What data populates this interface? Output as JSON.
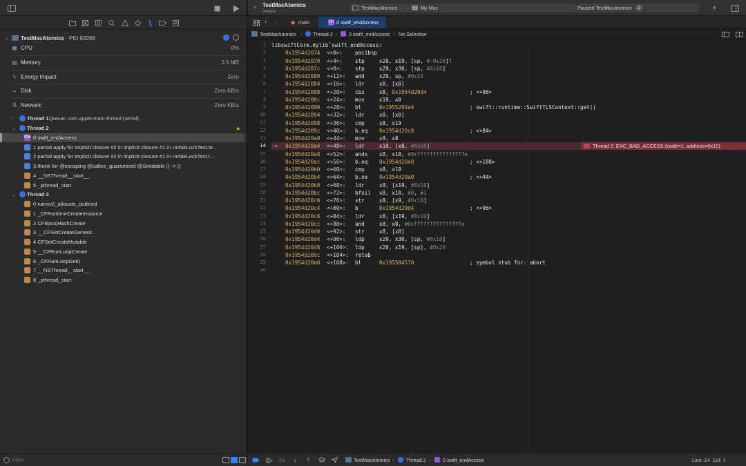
{
  "window": {
    "project_name": "TestMacAtomics",
    "branch": "master",
    "status": "Paused TestMacAtomics",
    "status_count": "2"
  },
  "scheme": {
    "scheme_name": "TestMacAtomics",
    "destination": "My Mac"
  },
  "tabs": [
    {
      "label": "main"
    },
    {
      "label": "0 swift_endAccess"
    }
  ],
  "jumpbar": {
    "crumbs": [
      "TestMacAtomics",
      "Thread 2",
      "0 swift_endAccess",
      "No Selection"
    ]
  },
  "process": {
    "name": "TestMacAtomics",
    "pid": "PID 83298"
  },
  "gauges": [
    {
      "label": "CPU",
      "value": "0%",
      "icon": "cpu-icon"
    },
    {
      "label": "Memory",
      "value": "3.5 MB",
      "icon": "memory-icon"
    },
    {
      "label": "Energy Impact",
      "value": "Zero",
      "icon": "energy-icon"
    },
    {
      "label": "Disk",
      "value": "Zero KB/s",
      "icon": "disk-icon"
    },
    {
      "label": "Network",
      "value": "Zero KB/s",
      "icon": "network-icon"
    }
  ],
  "threads": [
    {
      "label": "Thread 1",
      "queue": "Queue: com.apple.main-thread (serial)",
      "expanded": false,
      "frames": []
    },
    {
      "label": "Thread 2",
      "queue": "",
      "expanded": true,
      "warning": true,
      "frames": [
        {
          "label": "0 swift_endAccess",
          "icon": "purple",
          "selected": true
        },
        {
          "label": "1 partial apply for implicit closure #2 in implicit closure #1 in UnfairLockTest.te...",
          "icon": "blue"
        },
        {
          "label": "2 partial apply for implicit closure #2 in implicit closure #1 in UnfairLockTest.t...",
          "icon": "blue"
        },
        {
          "label": "3 thunk for @escaping @callee_guaranteed @Sendable () -> ()",
          "icon": "blue"
        },
        {
          "label": "4 __NSThread__start__",
          "icon": "tan"
        },
        {
          "label": "5 _pthread_start",
          "icon": "tan"
        }
      ]
    },
    {
      "label": "Thread 3",
      "queue": "",
      "expanded": true,
      "frames": [
        {
          "label": "0 nanov2_allocate_outlined",
          "icon": "tan"
        },
        {
          "label": "1 _CFRuntimeCreateInstance",
          "icon": "tan"
        },
        {
          "label": "2 CFBasicHashCreate",
          "icon": "tan"
        },
        {
          "label": "3 __CFSetCreateGeneric",
          "icon": "tan"
        },
        {
          "label": "4 CFSetCreateMutable",
          "icon": "tan"
        },
        {
          "label": "5 __CFRunLoopCreate",
          "icon": "tan"
        },
        {
          "label": "6 _CFRunLoopGet0",
          "icon": "tan"
        },
        {
          "label": "7 __NSThread__start__",
          "icon": "tan"
        },
        {
          "label": "8 _pthread_start",
          "icon": "tan"
        }
      ]
    }
  ],
  "filter_placeholder": "Filter",
  "code": {
    "header": "libswiftCore.dylib`swift_endAccess:",
    "lines": [
      {
        "addr": "0x1954d2074",
        "off": "<+0>:",
        "op": "pacibsp",
        "args": "",
        "comment": ""
      },
      {
        "addr": "0x1954d2078",
        "off": "<+4>:",
        "op": "stp",
        "args": "x20, x19, [sp, #-0x20]!",
        "comment": ""
      },
      {
        "addr": "0x1954d207c",
        "off": "<+8>:",
        "op": "stp",
        "args": "x29, x30, [sp, #0x10]",
        "comment": ""
      },
      {
        "addr": "0x1954d2080",
        "off": "<+12>:",
        "op": "add",
        "args": "x29, sp, #0x10",
        "comment": ""
      },
      {
        "addr": "0x1954d2084",
        "off": "<+16>:",
        "op": "ldr",
        "args": "x8, [x0]",
        "comment": ""
      },
      {
        "addr": "0x1954d2088",
        "off": "<+20>:",
        "op": "cbz",
        "args": "x8, 0x1954d20d4",
        "comment": "; <+96>"
      },
      {
        "addr": "0x1954d208c",
        "off": "<+24>:",
        "op": "mov",
        "args": "x19, x0",
        "comment": ""
      },
      {
        "addr": "0x1954d2090",
        "off": "<+28>:",
        "op": "bl",
        "args": "0x1955296a4",
        "comment": "; swift::runtime::SwiftTLSContext::get()"
      },
      {
        "addr": "0x1954d2094",
        "off": "<+32>:",
        "op": "ldr",
        "args": "x8, [x0]",
        "comment": ""
      },
      {
        "addr": "0x1954d2098",
        "off": "<+36>:",
        "op": "cmp",
        "args": "x8, x19",
        "comment": ""
      },
      {
        "addr": "0x1954d209c",
        "off": "<+40>:",
        "op": "b.eq",
        "args": "0x1954d20c8",
        "comment": "; <+84>"
      },
      {
        "addr": "0x1954d20a0",
        "off": "<+44>:",
        "op": "mov",
        "args": "x9, x8",
        "comment": ""
      },
      {
        "addr": "0x1954d20a4",
        "off": "<+48>:",
        "op": "ldr",
        "args": "x10, [x8, #0x10]",
        "comment": ""
      },
      {
        "addr": "0x1954d20a8",
        "off": "<+52>:",
        "op": "ands",
        "args": "x8, x10, #0xfffffffffffffffe",
        "comment": ""
      },
      {
        "addr": "0x1954d20ac",
        "off": "<+56>:",
        "op": "b.eq",
        "args": "0x1954d20e0",
        "comment": "; <+108>"
      },
      {
        "addr": "0x1954d20b0",
        "off": "<+60>:",
        "op": "cmp",
        "args": "x8, x19",
        "comment": ""
      },
      {
        "addr": "0x1954d20b4",
        "off": "<+64>:",
        "op": "b.ne",
        "args": "0x1954d20a0",
        "comment": "; <+44>"
      },
      {
        "addr": "0x1954d20b8",
        "off": "<+68>:",
        "op": "ldr",
        "args": "x8, [x19, #0x10]",
        "comment": ""
      },
      {
        "addr": "0x1954d20bc",
        "off": "<+72>:",
        "op": "bfxil",
        "args": "x8, x10, #0, #1",
        "comment": ""
      },
      {
        "addr": "0x1954d20c0",
        "off": "<+76>:",
        "op": "str",
        "args": "x8, [x9, #0x10]",
        "comment": ""
      },
      {
        "addr": "0x1954d20c4",
        "off": "<+80>:",
        "op": "b",
        "args": "0x1954d20d4",
        "comment": "; <+96>"
      },
      {
        "addr": "0x1954d20c8",
        "off": "<+84>:",
        "op": "ldr",
        "args": "x8, [x19, #0x10]",
        "comment": ""
      },
      {
        "addr": "0x1954d20cc",
        "off": "<+88>:",
        "op": "and",
        "args": "x8, x8, #0xfffffffffffffffe",
        "comment": ""
      },
      {
        "addr": "0x1954d20d0",
        "off": "<+92>:",
        "op": "str",
        "args": "x8, [x0]",
        "comment": ""
      },
      {
        "addr": "0x1954d20d4",
        "off": "<+96>:",
        "op": "ldp",
        "args": "x29, x30, [sp, #0x10]",
        "comment": ""
      },
      {
        "addr": "0x1954d20d8",
        "off": "<+100>:",
        "op": "ldp",
        "args": "x20, x19, [sp], #0x20",
        "comment": ""
      },
      {
        "addr": "0x1954d20dc",
        "off": "<+104>:",
        "op": "retab",
        "args": "",
        "comment": ""
      },
      {
        "addr": "0x1954d20e0",
        "off": "<+108>:",
        "op": "bl",
        "args": "0x195594570",
        "comment": "; symbol stub for: abort"
      }
    ],
    "current_line": 14,
    "pc_marker": "->",
    "error_message": "Thread 2: EXC_BAD_ACCESS (code=1, address=0x10)"
  },
  "debug_bar": {
    "crumbs": [
      "TestMacAtomics",
      "Thread 2",
      "0 swift_endAccess"
    ],
    "cursor": "Line: 14  Col: 1"
  }
}
